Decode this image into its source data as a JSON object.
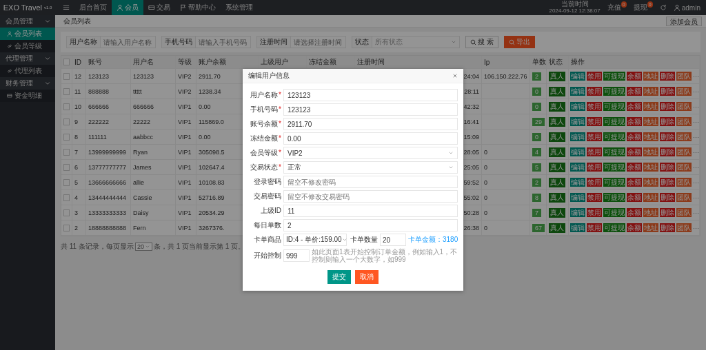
{
  "app": {
    "logo": "EXO Travel $^{v1.0}$"
  },
  "top_nav": [
    {
      "kind": "menu",
      "selected": false
    },
    {
      "kind": "link",
      "label": "后台首页",
      "selected": false
    },
    {
      "kind": "link",
      "label": "会员",
      "selected": true
    },
    {
      "kind": "link",
      "label": "交易",
      "selected": false
    },
    {
      "kind": "link",
      "label": "帮助中心",
      "selected": false
    },
    {
      "kind": "link",
      "label": "系统管理",
      "selected": false
    }
  ],
  "clock": {
    "label": "当前时间",
    "value": "2024-09-12 12:38:07"
  },
  "top_actions": [
    {
      "label": "充值",
      "badge": "0"
    },
    {
      "label": "提现",
      "badge": "0"
    }
  ],
  "user": {
    "name": "admin"
  },
  "sidebar": {
    "groups": [
      {
        "label": "会员管理",
        "expanded": true,
        "children": [
          {
            "label": "会员列表",
            "selected": true
          },
          {
            "label": "会员等级",
            "selected": false
          }
        ]
      },
      {
        "label": "代理管理",
        "expanded": true,
        "children": [
          {
            "label": "代理列表",
            "selected": false
          }
        ]
      },
      {
        "label": "财务管理",
        "expanded": true,
        "children": [
          {
            "label": "资金明细",
            "selected": false
          }
        ]
      }
    ]
  },
  "breadcrumb": "会员列表",
  "add_button": "添加会员",
  "filters": [
    {
      "kind": "input",
      "label": "用户名称",
      "placeholder": "请输入用户名称"
    },
    {
      "kind": "input",
      "label": "手机号码",
      "placeholder": "请输入手机号码"
    },
    {
      "kind": "input",
      "label": "注册时间",
      "placeholder": "请选择注册时间"
    },
    {
      "kind": "select",
      "label": "状态",
      "placeholder": "所有状态"
    }
  ],
  "filter_buttons": [
    {
      "kind": "search",
      "label": "搜 索"
    },
    {
      "kind": "export",
      "label": "导出"
    }
  ],
  "table": {
    "header_checked": false,
    "columns": [
      "ID",
      "账号",
      "用户名",
      "等级",
      "账户余额",
      "上级用户",
      "冻结金额",
      "注册时间",
      "Ip",
      "单数",
      "状态",
      "操作"
    ],
    "rows": [
      {
        "checked": false,
        "id": "12",
        "account": "123123",
        "username": "123123",
        "level": "VIP2",
        "balance": "2911.70",
        "register_time": "24:04",
        "ip": "106.150.222.76",
        "count": "2",
        "status": "真人",
        "actions": [
          {
            "label": "编辑",
            "color": "#00574f"
          },
          {
            "label": "禁用",
            "color": "#821010"
          },
          {
            "label": "可提现",
            "color": "#0c500c"
          },
          {
            "label": "余额",
            "color": "#821010"
          },
          {
            "label": "地址",
            "color": "#8b3a1a"
          },
          {
            "label": "删除",
            "color": "#821010"
          },
          {
            "label": "团队",
            "color": "#8b3a1a"
          }
        ],
        "more": "···"
      },
      {
        "checked": false,
        "id": "11",
        "account": "888888",
        "username": "ttttt",
        "level": "VIP2",
        "balance": "1238.34",
        "register_time": "28:11",
        "count": "0",
        "status": "真人",
        "actions": [
          {
            "label": "编辑",
            "color": "#00574f"
          },
          {
            "label": "禁用",
            "color": "#821010"
          },
          {
            "label": "可提现",
            "color": "#0c500c"
          },
          {
            "label": "余额",
            "color": "#821010"
          },
          {
            "label": "地址",
            "color": "#8b3a1a"
          },
          {
            "label": "删除",
            "color": "#821010"
          },
          {
            "label": "团队",
            "color": "#8b3a1a"
          }
        ],
        "more": "···"
      },
      {
        "checked": false,
        "id": "10",
        "account": "666666",
        "username": "666666",
        "level": "VIP1",
        "balance": "0.00",
        "register_time": "42:32",
        "count": "0",
        "status": "真人",
        "actions": [
          {
            "label": "编辑",
            "color": "#00574f"
          },
          {
            "label": "禁用",
            "color": "#821010"
          },
          {
            "label": "可提现",
            "color": "#0c500c"
          },
          {
            "label": "余额",
            "color": "#821010"
          },
          {
            "label": "地址",
            "color": "#8b3a1a"
          },
          {
            "label": "删除",
            "color": "#821010"
          },
          {
            "label": "团队",
            "color": "#8b3a1a"
          }
        ],
        "more": "···"
      },
      {
        "checked": false,
        "id": "9",
        "account": "222222",
        "username": "22222",
        "level": "VIP1",
        "balance": "115869.0",
        "register_time": "16:41",
        "count": "29",
        "status": "真人",
        "actions": [
          {
            "label": "编辑",
            "color": "#00574f"
          },
          {
            "label": "禁用",
            "color": "#821010"
          },
          {
            "label": "可提现",
            "color": "#0c500c"
          },
          {
            "label": "余额",
            "color": "#821010"
          },
          {
            "label": "地址",
            "color": "#8b3a1a"
          },
          {
            "label": "删除",
            "color": "#821010"
          },
          {
            "label": "团队",
            "color": "#8b3a1a"
          }
        ],
        "more": "···"
      },
      {
        "checked": false,
        "id": "8",
        "account": "111111",
        "username": "aabbcc",
        "level": "VIP1",
        "balance": "0.00",
        "register_time": "15:09",
        "count": "0",
        "status": "真人",
        "actions": [
          {
            "label": "编辑",
            "color": "#00574f"
          },
          {
            "label": "禁用",
            "color": "#821010"
          },
          {
            "label": "可提现",
            "color": "#0c500c"
          },
          {
            "label": "余额",
            "color": "#821010"
          },
          {
            "label": "地址",
            "color": "#8b3a1a"
          },
          {
            "label": "删除",
            "color": "#821010"
          },
          {
            "label": "团队",
            "color": "#8b3a1a"
          }
        ],
        "more": "···"
      },
      {
        "checked": false,
        "id": "7",
        "account": "13999999999",
        "username": "Ryan",
        "level": "VIP1",
        "balance": "305098.5",
        "register_time": "28:05",
        "ip": "0",
        "count": "4",
        "status": "真人",
        "actions": [
          {
            "label": "编辑",
            "color": "#00574f"
          },
          {
            "label": "禁用",
            "color": "#821010"
          },
          {
            "label": "可提现",
            "color": "#0c500c"
          },
          {
            "label": "余额",
            "color": "#821010"
          },
          {
            "label": "地址",
            "color": "#8b3a1a"
          },
          {
            "label": "删除",
            "color": "#821010"
          },
          {
            "label": "团队",
            "color": "#8b3a1a"
          }
        ],
        "more": "···"
      },
      {
        "checked": false,
        "id": "6",
        "account": "13777777777",
        "username": "James",
        "level": "VIP1",
        "balance": "102647.4",
        "register_time": "25:05",
        "ip": "0",
        "count": "5",
        "status": "真人",
        "actions": [
          {
            "label": "编辑",
            "color": "#00574f"
          },
          {
            "label": "禁用",
            "color": "#821010"
          },
          {
            "label": "可提现",
            "color": "#0c500c"
          },
          {
            "label": "余额",
            "color": "#821010"
          },
          {
            "label": "地址",
            "color": "#8b3a1a"
          },
          {
            "label": "删除",
            "color": "#821010"
          },
          {
            "label": "团队",
            "color": "#8b3a1a"
          }
        ],
        "more": "···"
      },
      {
        "checked": false,
        "id": "5",
        "account": "13666666666",
        "username": "allie",
        "level": "VIP1",
        "balance": "10108.83",
        "register_time": "59:52",
        "ip": "0",
        "count": "2",
        "status": "真人",
        "actions": [
          {
            "label": "编辑",
            "color": "#00574f"
          },
          {
            "label": "禁用",
            "color": "#821010"
          },
          {
            "label": "可提现",
            "color": "#0c500c"
          },
          {
            "label": "余额",
            "color": "#821010"
          },
          {
            "label": "地址",
            "color": "#8b3a1a"
          },
          {
            "label": "删除",
            "color": "#821010"
          },
          {
            "label": "团队",
            "color": "#8b3a1a"
          }
        ],
        "more": "···"
      },
      {
        "checked": false,
        "id": "4",
        "account": "13444444444",
        "username": "Cassie",
        "level": "VIP1",
        "balance": "52716.89",
        "register_time": "55:02",
        "ip": "0",
        "count": "8",
        "status": "真人",
        "actions": [
          {
            "label": "编辑",
            "color": "#00574f"
          },
          {
            "label": "禁用",
            "color": "#821010"
          },
          {
            "label": "可提现",
            "color": "#0c500c"
          },
          {
            "label": "余额",
            "color": "#821010"
          },
          {
            "label": "地址",
            "color": "#8b3a1a"
          },
          {
            "label": "删除",
            "color": "#821010"
          },
          {
            "label": "团队",
            "color": "#8b3a1a"
          }
        ],
        "more": "···"
      },
      {
        "checked": false,
        "id": "3",
        "account": "13333333333",
        "username": "Daisy",
        "level": "VIP1",
        "balance": "20534.29",
        "register_time": "50:28",
        "ip": "0",
        "count": "7",
        "status": "真人",
        "actions": [
          {
            "label": "编辑",
            "color": "#00574f"
          },
          {
            "label": "禁用",
            "color": "#821010"
          },
          {
            "label": "可提现",
            "color": "#0c500c"
          },
          {
            "label": "余额",
            "color": "#821010"
          },
          {
            "label": "地址",
            "color": "#8b3a1a"
          },
          {
            "label": "删除",
            "color": "#821010"
          },
          {
            "label": "团队",
            "color": "#8b3a1a"
          }
        ],
        "more": "···"
      },
      {
        "checked": false,
        "id": "2",
        "account": "18888888888",
        "username": "Fern",
        "level": "VIP1",
        "balance": "3267376.",
        "register_time": "26:38",
        "ip": "0",
        "count": "67",
        "status": "真人",
        "actions": [
          {
            "label": "编辑",
            "color": "#00574f"
          },
          {
            "label": "禁用",
            "color": "#821010"
          },
          {
            "label": "可提现",
            "color": "#0c500c"
          },
          {
            "label": "余额",
            "color": "#821010"
          },
          {
            "label": "地址",
            "color": "#8b3a1a"
          },
          {
            "label": "删除",
            "color": "#821010"
          },
          {
            "label": "团队",
            "color": "#8b3a1a"
          }
        ],
        "more": "···"
      }
    ]
  },
  "pagination": {
    "before": "共 11 条记录，每页显示",
    "page_size": "20",
    "after": "条，共 1 页当前显示第 1 页。"
  },
  "dialog": {
    "title": "编辑用户信息",
    "rows": [
      [
        {
          "kind": "input",
          "label": "用户名称",
          "mark": "*",
          "value": "123123"
        }
      ],
      [
        {
          "kind": "input",
          "label": "手机号码",
          "mark": "*",
          "value": "123123"
        }
      ],
      [
        {
          "kind": "input",
          "label": "账号余额",
          "mark": "*",
          "value": "2911.70"
        }
      ],
      [
        {
          "kind": "input",
          "label": "冻结金额",
          "mark": "*",
          "value": "0.00"
        }
      ],
      [
        {
          "kind": "select",
          "label": "会员等级",
          "mark": "*",
          "value": "VIP2"
        }
      ],
      [
        {
          "kind": "select",
          "label": "交易状态",
          "mark": "*",
          "value": "正常"
        }
      ],
      [
        {
          "kind": "input",
          "label": "登录密码",
          "placeholder": "留空不修改密码"
        }
      ],
      [
        {
          "kind": "input",
          "label": "交易密码",
          "placeholder": "留空不修改交易密码"
        }
      ],
      [
        {
          "kind": "input",
          "label": "上级ID",
          "value": "11"
        }
      ],
      [
        {
          "kind": "input",
          "label": "每日单数",
          "value": "2"
        }
      ],
      [
        {
          "kind": "select",
          "label": "卡单商品",
          "value": "ID:4 - 单价:159.00"
        },
        {
          "kind": "input",
          "label": "卡单数量",
          "value": "20"
        },
        {
          "kind": "note",
          "text": "卡单金额：3180"
        }
      ],
      [
        {
          "kind": "input",
          "label": "开始控制",
          "value": "999"
        },
        {
          "kind": "hint",
          "text": "如此页面1表开始控制订单金额，例如输入1，不控制则输入一个大数字，如999"
        }
      ]
    ],
    "buttons": [
      {
        "kind": "primary",
        "label": "提交"
      },
      {
        "kind": "cancel",
        "label": "取消"
      }
    ]
  }
}
